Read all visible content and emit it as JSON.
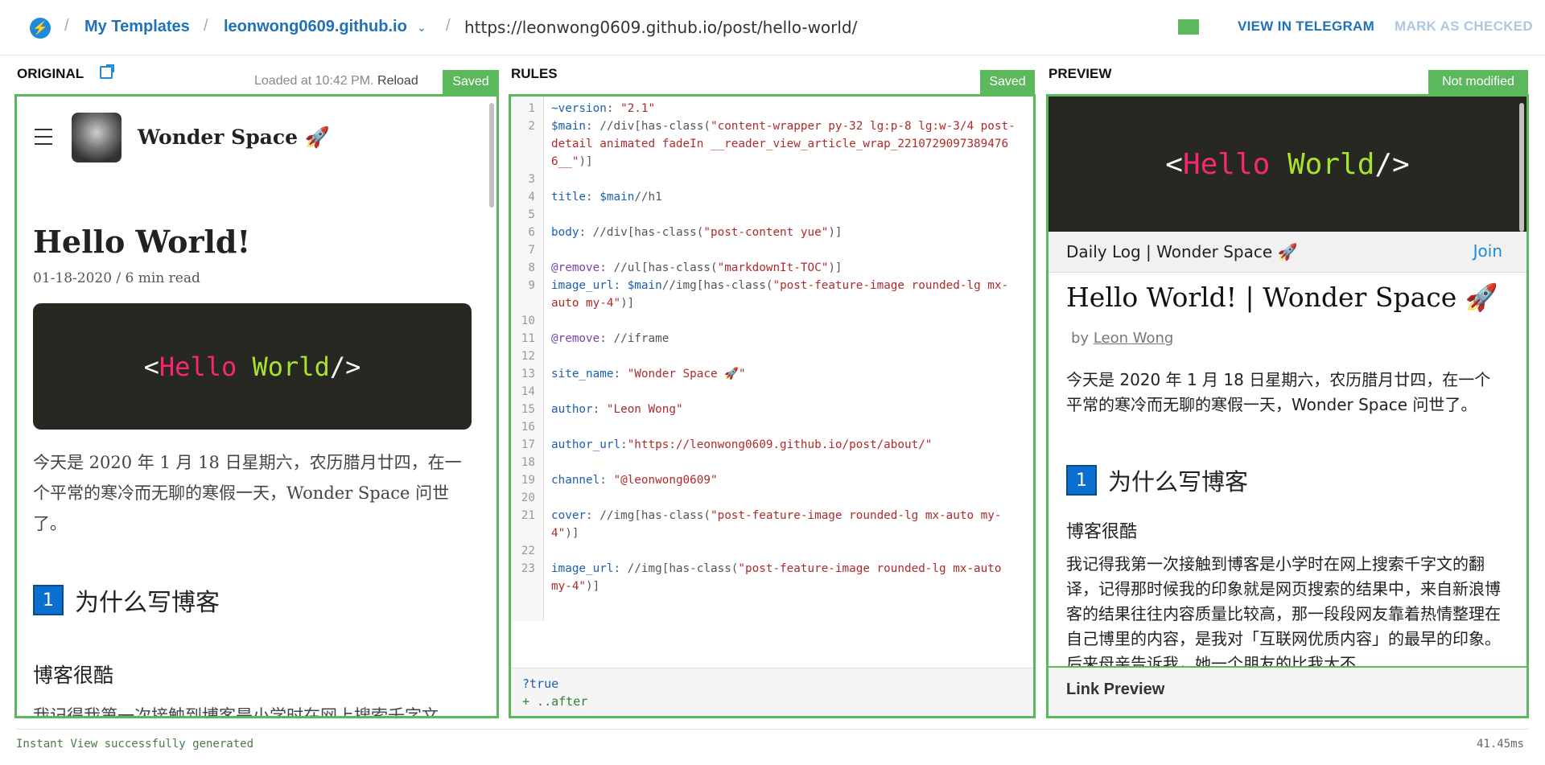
{
  "topbar": {
    "crumb_my_templates": "My Templates",
    "crumb_site": "leonwong0609.github.io",
    "url": "https://leonwong0609.github.io/post/hello-world/",
    "view_in_telegram": "VIEW IN TELEGRAM",
    "mark_as_checked": "MARK AS CHECKED",
    "separator": "/",
    "site_chevron": "⌄",
    "logo_glyph": "⚡"
  },
  "original": {
    "heading": "ORIGINAL",
    "loaded_text": "Loaded at 10:42 PM.",
    "reload": "Reload",
    "badge": "Saved",
    "site_title": "Wonder Space 🚀",
    "post_title": "Hello World!",
    "post_meta": "01-18-2020 / 6 min read",
    "hero_lt": "<",
    "hero_hello": "Hello",
    "hero_world": " World",
    "hero_end": "/>",
    "para": "今天是 2020 年 1 月 18 日星期六，农历腊月廿四，在一个平常的寒冷而无聊的寒假一天，Wonder Space 问世了。",
    "h2_num": "1",
    "h2": "为什么写博客",
    "h3": "博客很酷",
    "para2": "我记得我第一次接触到博客是小学时在网上搜索千字文"
  },
  "rules": {
    "heading": "RULES",
    "badge": "Saved",
    "lines": [
      {
        "n": "1",
        "parts": [
          {
            "c": "k",
            "t": "~version"
          },
          {
            "c": "p",
            "t": ": "
          },
          {
            "c": "s",
            "t": "\"2.1\""
          }
        ]
      },
      {
        "n": "2",
        "parts": [
          {
            "c": "k",
            "t": "$main"
          },
          {
            "c": "p",
            "t": ": //div[has-class("
          },
          {
            "c": "s",
            "t": "\"content-wrapper py-32 lg:p-8 lg:w-3/4 post-detail animated fadeIn __reader_view_article_wrap_2210729097389476​6__\""
          },
          {
            "c": "p",
            "t": ")]"
          }
        ]
      },
      {
        "n": "3",
        "parts": []
      },
      {
        "n": "4",
        "parts": [
          {
            "c": "k",
            "t": "title"
          },
          {
            "c": "p",
            "t": ": "
          },
          {
            "c": "k",
            "t": "$main"
          },
          {
            "c": "p",
            "t": "//h1"
          }
        ]
      },
      {
        "n": "5",
        "parts": []
      },
      {
        "n": "6",
        "parts": [
          {
            "c": "k",
            "t": "body"
          },
          {
            "c": "p",
            "t": ": //div[has-class("
          },
          {
            "c": "s",
            "t": "\"post-content yue\""
          },
          {
            "c": "p",
            "t": ")]"
          }
        ]
      },
      {
        "n": "7",
        "parts": []
      },
      {
        "n": "8",
        "parts": [
          {
            "c": "d",
            "t": "@remove"
          },
          {
            "c": "p",
            "t": ": //ul[has-class("
          },
          {
            "c": "s",
            "t": "\"markdownIt-TOC\""
          },
          {
            "c": "p",
            "t": ")]"
          }
        ]
      },
      {
        "n": "9",
        "parts": [
          {
            "c": "k",
            "t": "image_url"
          },
          {
            "c": "p",
            "t": ": "
          },
          {
            "c": "k",
            "t": "$main"
          },
          {
            "c": "p",
            "t": "//img[has-class("
          },
          {
            "c": "s",
            "t": "\"post-feature-image rounded-lg mx-auto my-4\""
          },
          {
            "c": "p",
            "t": ")]"
          }
        ]
      },
      {
        "n": "10",
        "parts": []
      },
      {
        "n": "11",
        "parts": [
          {
            "c": "d",
            "t": "@remove"
          },
          {
            "c": "p",
            "t": ": //iframe"
          }
        ]
      },
      {
        "n": "12",
        "parts": []
      },
      {
        "n": "13",
        "parts": [
          {
            "c": "k",
            "t": "site_name"
          },
          {
            "c": "p",
            "t": ": "
          },
          {
            "c": "s",
            "t": "\"Wonder Space 🚀\""
          }
        ]
      },
      {
        "n": "14",
        "parts": []
      },
      {
        "n": "15",
        "parts": [
          {
            "c": "k",
            "t": "author"
          },
          {
            "c": "p",
            "t": ": "
          },
          {
            "c": "s",
            "t": "\"Leon Wong\""
          }
        ]
      },
      {
        "n": "16",
        "parts": []
      },
      {
        "n": "17",
        "parts": [
          {
            "c": "k",
            "t": "author_url"
          },
          {
            "c": "p",
            "t": ":"
          },
          {
            "c": "s",
            "t": "\"https://leonwong0609.github.io/post/about/\""
          }
        ]
      },
      {
        "n": "18",
        "parts": []
      },
      {
        "n": "19",
        "parts": [
          {
            "c": "k",
            "t": "channel"
          },
          {
            "c": "p",
            "t": ": "
          },
          {
            "c": "s",
            "t": "\"@leonwong0609\""
          }
        ]
      },
      {
        "n": "20",
        "parts": []
      },
      {
        "n": "21",
        "parts": [
          {
            "c": "k",
            "t": "cover"
          },
          {
            "c": "p",
            "t": ": //img[has-class("
          },
          {
            "c": "s",
            "t": "\"post-feature-image rounded-lg mx-auto my-4\""
          },
          {
            "c": "p",
            "t": ")]"
          }
        ]
      },
      {
        "n": "22",
        "parts": []
      },
      {
        "n": "23",
        "parts": [
          {
            "c": "k",
            "t": "image_url"
          },
          {
            "c": "p",
            "t": ": //img[has-class("
          },
          {
            "c": "s",
            "t": "\"post-feature-image rounded-lg mx-auto my-4\""
          },
          {
            "c": "p",
            "t": ")]"
          }
        ]
      }
    ],
    "footer_line1": "?true",
    "footer_line2": "+ ..after"
  },
  "preview": {
    "heading": "PREVIEW",
    "badge": "Not modified",
    "hero_lt": "<",
    "hero_hello": "Hello",
    "hero_world": " World",
    "hero_end": "/>",
    "channel": "Daily Log | Wonder Space 🚀",
    "join": "Join",
    "title": "Hello World! | Wonder Space 🚀",
    "by_prefix": "by ",
    "author": "Leon Wong",
    "para": "今天是 2020 年 1 月 18 日星期六，农历腊月廿四，在一个平常的寒冷而无聊的寒假一天，Wonder Space 问世了。",
    "h2_num": "1",
    "h2": "为什么写博客",
    "h3": "博客很酷",
    "para2": "我记得我第一次接触到博客是小学时在网上搜索千字文的翻译，记得那时候我的印象就是网页搜索的结果中，来自新浪博客的结果往往内容质量比较高，那一段段网友靠着热情整理在自己博里的内容，是我对「互联网优质内容」的最早的印象。后来母亲告诉我，她一个朋友的比我大不",
    "footer": "Link Preview"
  },
  "status": {
    "message": "Instant View successfully generated",
    "timing": "41.45ms"
  },
  "colors": {
    "accent_green": "#5cb85c",
    "link_blue": "#1f72b8",
    "muted_blue": "#a9c9e4"
  }
}
